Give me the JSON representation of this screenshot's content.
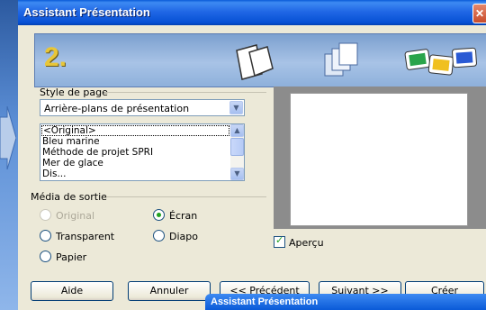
{
  "window": {
    "title": "Assistant Présentation"
  },
  "banner": {
    "step": "2."
  },
  "page_style": {
    "label": "Style de page",
    "selected": "Arrière-plans de présentation",
    "list_items": [
      "<Original>",
      "Bleu marine",
      "Méthode de projet SPRI",
      "Mer de glace",
      "Dis..."
    ]
  },
  "output_media": {
    "label": "Média de sortie",
    "options": {
      "original": "Original",
      "screen": "Écran",
      "transparent": "Transparent",
      "slide": "Diapo",
      "paper": "Papier"
    },
    "selected": "Écran"
  },
  "preview": {
    "checkbox_label": "Aperçu",
    "checked": true
  },
  "buttons": {
    "help": "Aide",
    "cancel": "Annuler",
    "previous": "<< Précédent",
    "next": "Suivant >>",
    "create": "Créer"
  },
  "sub_window": {
    "title": "Assistant Présentation"
  }
}
